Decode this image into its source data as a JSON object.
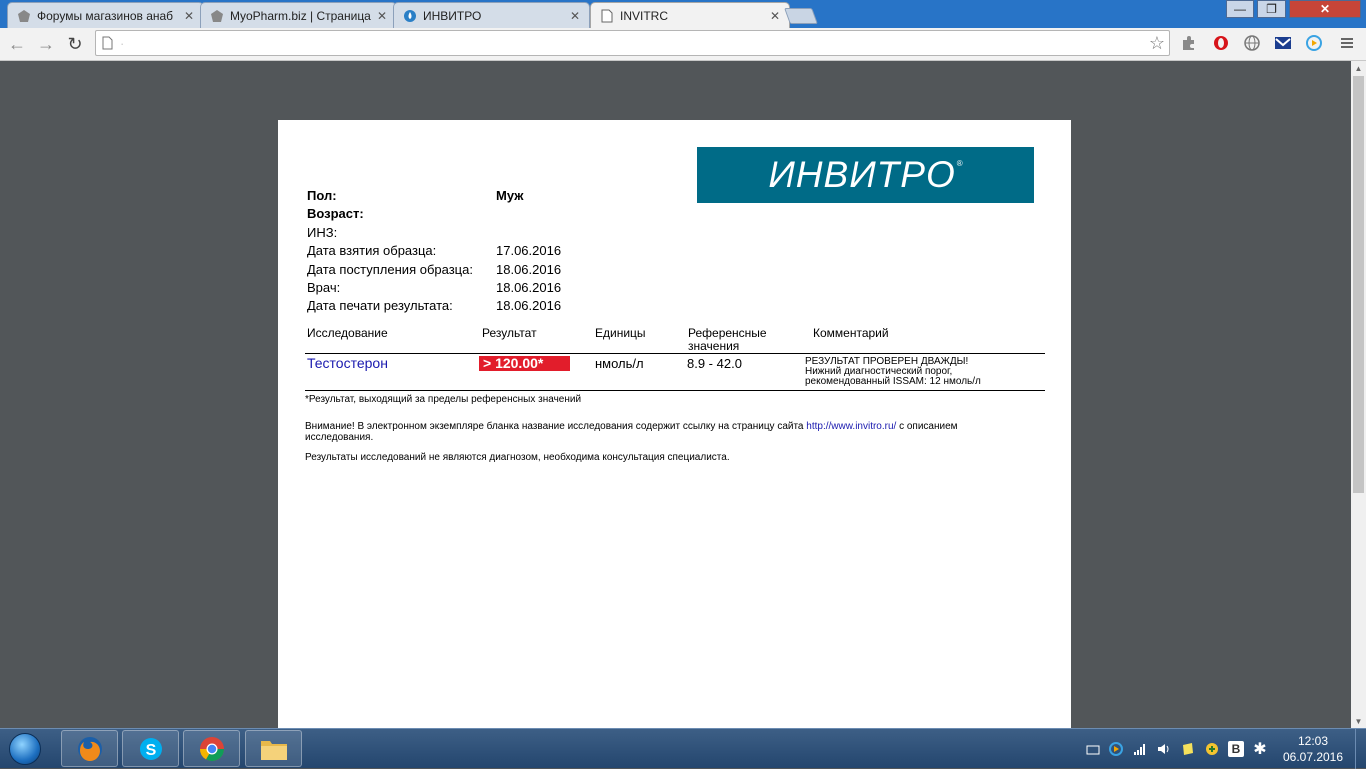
{
  "browser": {
    "tabs": [
      {
        "title": "Форумы магазинов анаб",
        "icon": "forum-favicon"
      },
      {
        "title": "MyoPharm.biz | Страница",
        "icon": "forum-favicon"
      },
      {
        "title": "ИНВИТРО",
        "icon": "invitro-drop-favicon"
      },
      {
        "title": "INVITRC",
        "icon": "page-favicon"
      }
    ],
    "close_glyph": "✕",
    "window_controls": {
      "minimize": "—",
      "maximize": "❐",
      "close": "✕"
    },
    "toolbar": {
      "back": "←",
      "forward": "→",
      "reload": "↻",
      "star": "☆",
      "url": "·"
    }
  },
  "document": {
    "logo_text": "ИНВИТРО",
    "logo_mark": "®",
    "fields": [
      {
        "label": "Пол:",
        "value": "Муж",
        "bold": true
      },
      {
        "label": "Возраст:",
        "value": "",
        "bold": true
      },
      {
        "label": "ИНЗ:",
        "value": "",
        "bold": false
      },
      {
        "label": "Дата взятия образца:",
        "value": "17.06.2016",
        "bold": false
      },
      {
        "label": "Дата поступления образца:",
        "value": "18.06.2016",
        "bold": false
      },
      {
        "label": "Врач:",
        "value": "18.06.2016",
        "bold": false
      },
      {
        "label": "Дата печати результата:",
        "value": "18.06.2016",
        "bold": false
      }
    ],
    "table": {
      "headers": {
        "test": "Исследование",
        "result": "Результат",
        "units": "Единицы",
        "reference_line1": "Референсные",
        "reference_line2": "значения",
        "comment": "Комментарий"
      },
      "row": {
        "test": "Тестостерон",
        "result": "> 120.00*",
        "units": "нмоль/л",
        "reference": "8.9 - 42.0",
        "comment_lines": [
          "РЕЗУЛЬТАТ ПРОВЕРЕН ДВАЖДЫ!",
          "Нижний диагностический порог,",
          "рекомендованный ISSAM: 12 нмоль/л"
        ]
      }
    },
    "footnote": "*Результат, выходящий за пределы референсных значений",
    "notice_prefix": "Внимание! В электронном экземпляре бланка название исследования содержит ссылку на страницу сайта",
    "notice_link": "http://www.invitro.ru/",
    "notice_suffix": "с описанием",
    "notice_line2": "исследования.",
    "disclaimer": "Результаты исследований не являются диагнозом, необходима консультация специалиста."
  },
  "taskbar": {
    "apps": [
      "firefox-icon",
      "skype-icon",
      "chrome-icon",
      "explorer-folder-icon"
    ],
    "time": "12:03",
    "date": "06.07.2016",
    "tray_letter": "B"
  },
  "colors": {
    "logo_bg": "#006b87",
    "result_badge": "#e21d2b",
    "link": "#1a1aaf",
    "viewer_bg": "#525659"
  }
}
